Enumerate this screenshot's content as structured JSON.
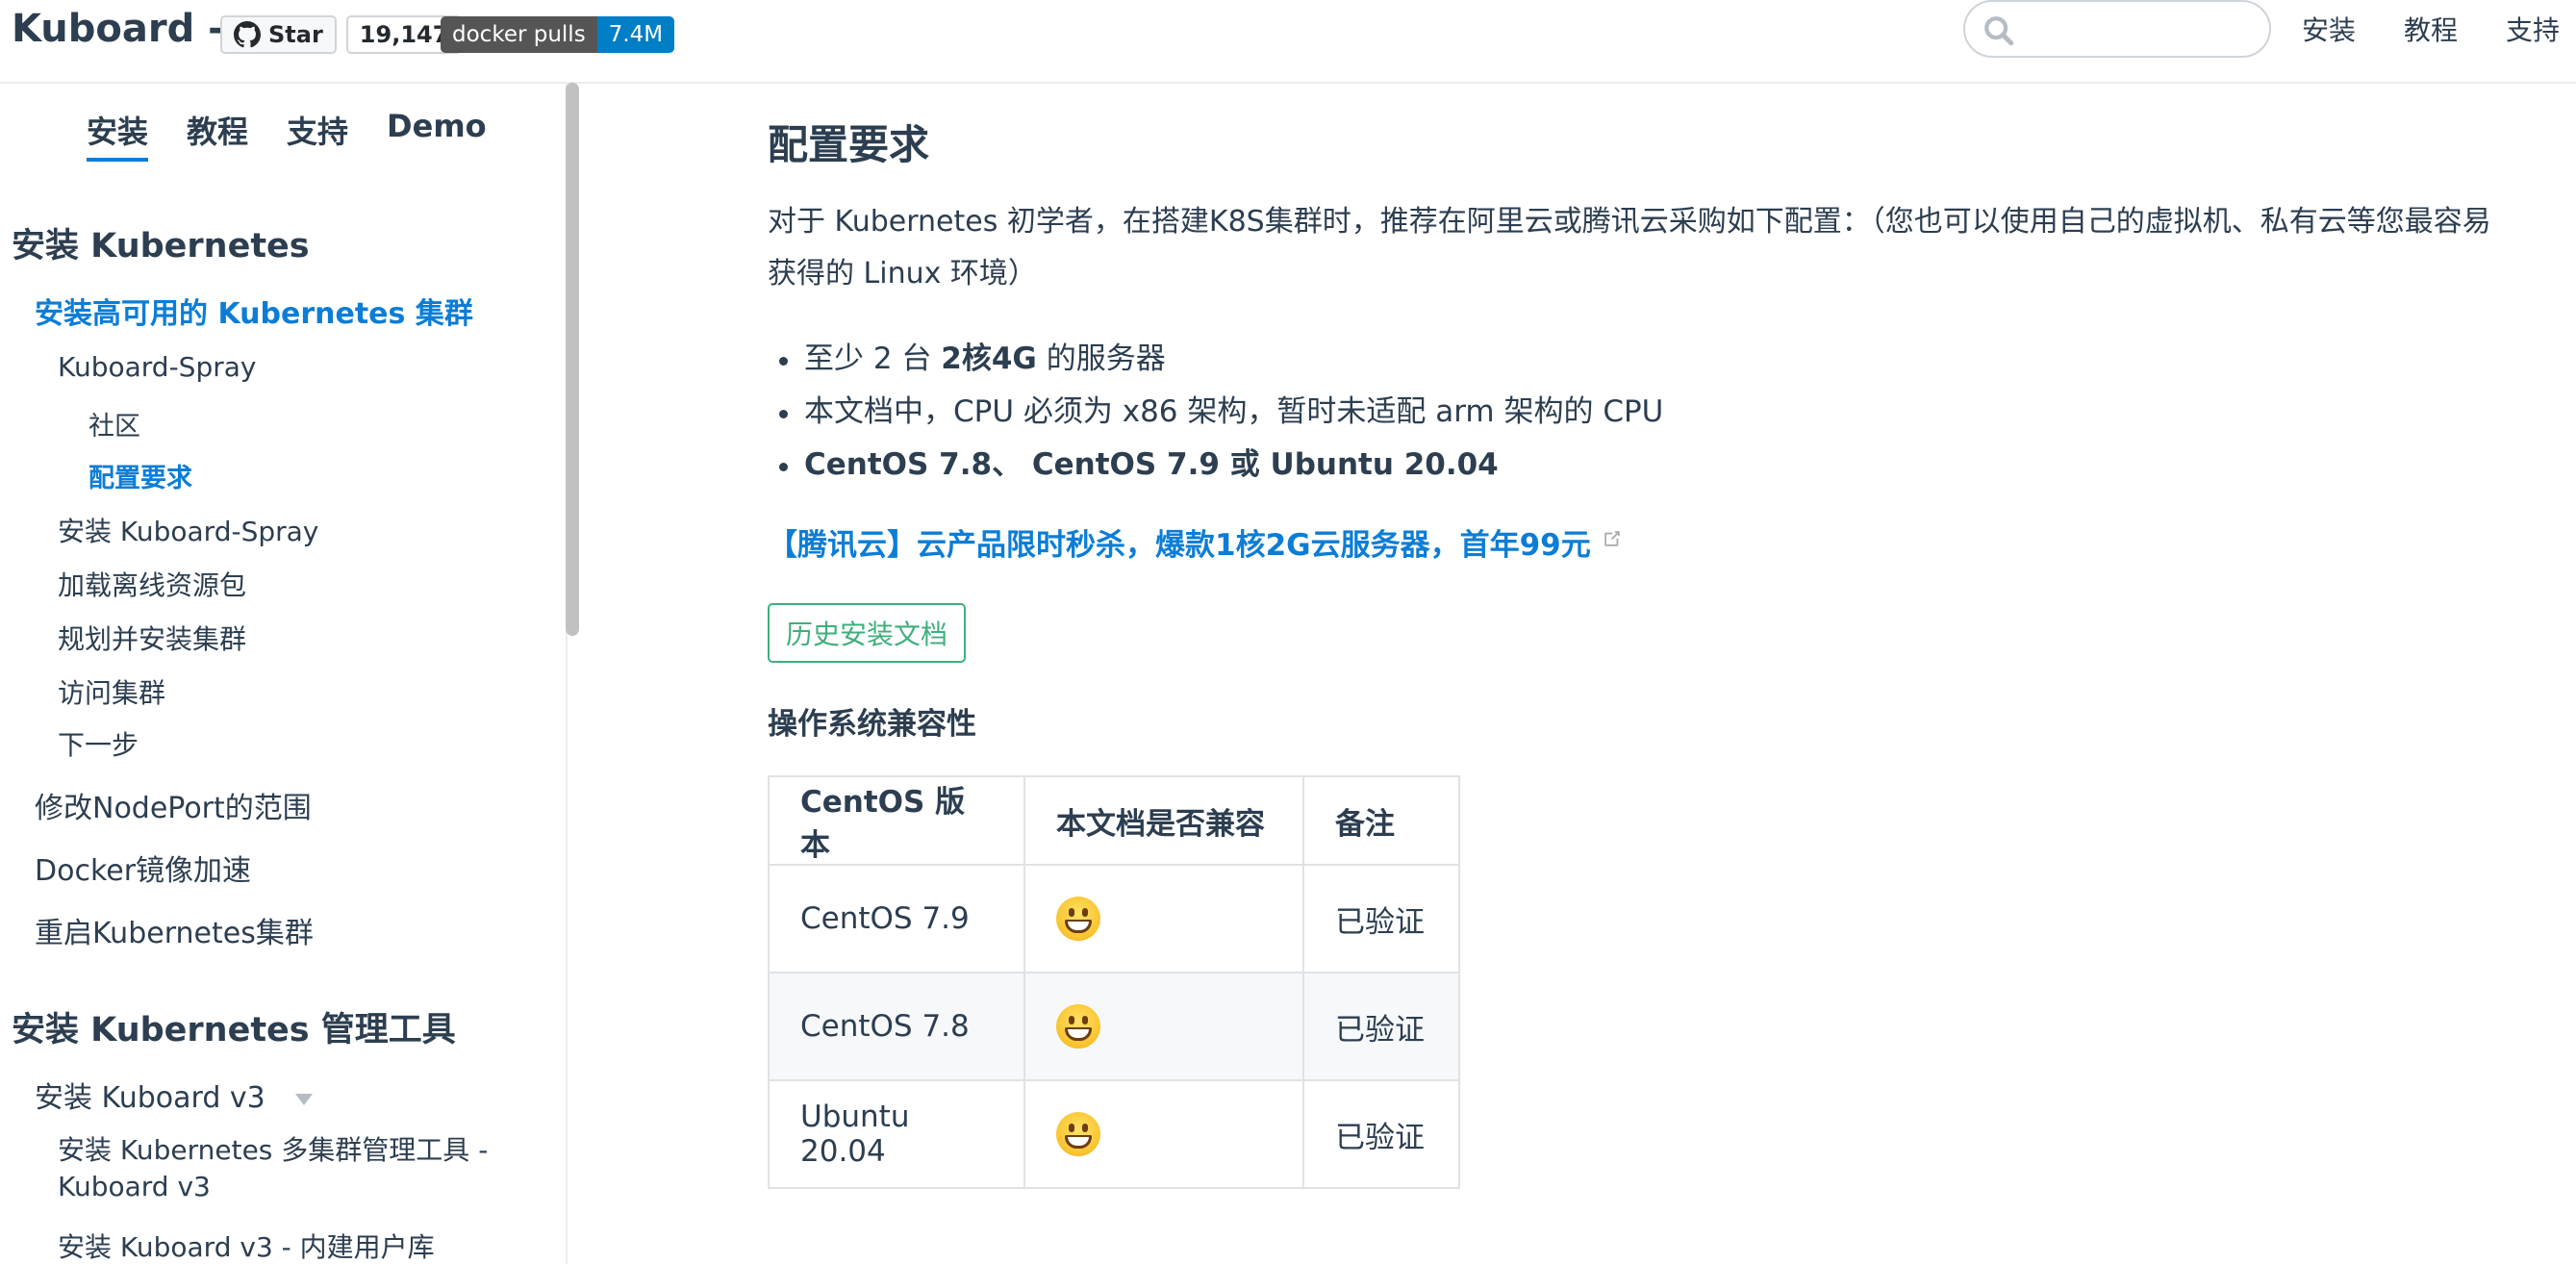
{
  "header": {
    "site_title": "Kuboard -",
    "github": {
      "star_label": "Star",
      "count": "19,147"
    },
    "docker": {
      "label": "docker pulls",
      "value": "7.4M"
    },
    "search": {
      "placeholder": ""
    },
    "nav": [
      "安装",
      "教程",
      "支持"
    ]
  },
  "sidebar": {
    "tabs": [
      "安装",
      "教程",
      "支持",
      "Demo"
    ],
    "active_tab": "安装",
    "group1": "安装 Kubernetes",
    "items": {
      "ha_cluster": "安装高可用的 Kubernetes 集群",
      "kuboard_spray": "Kuboard-Spray",
      "community": "社区",
      "requirements": "配置要求",
      "install_spray": "安装 Kuboard-Spray",
      "offline_pkg": "加载离线资源包",
      "plan_install": "规划并安装集群",
      "access": "访问集群",
      "next": "下一步",
      "nodeport": "修改NodePort的范围",
      "docker_mirror": "Docker镜像加速",
      "restart": "重启Kubernetes集群"
    },
    "group2": "安装 Kubernetes 管理工具",
    "items2": {
      "kuboard_v3": "安装 Kuboard v3",
      "multi_cluster": "安装 Kubernetes 多集群管理工具 - Kuboard v3",
      "builtin_users": "安装 Kuboard v3 - 内建用户库"
    }
  },
  "content": {
    "title": "配置要求",
    "intro": "对于 Kubernetes 初学者，在搭建K8S集群时，推荐在阿里云或腾讯云采购如下配置：（您也可以使用自己的虚拟机、私有云等您最容易获得的 Linux 环境）",
    "bullets": {
      "b1_pre": "至少 2 台 ",
      "b1_bold": "2核4G",
      "b1_post": " 的服务器",
      "b2": "本文档中，CPU 必须为 x86 架构，暂时未适配 arm 架构的 CPU",
      "b3_a": "CentOS 7.8",
      "b3_sep1": "、 ",
      "b3_b": "CentOS 7.9",
      "b3_sep2": " 或 ",
      "b3_c": "Ubuntu 20.04"
    },
    "promo_link": "【腾讯云】云产品限时秒杀，爆款1核2G云服务器，首年99元",
    "history_button": "历史安装文档",
    "compat_heading": "操作系统兼容性",
    "table": {
      "headers": [
        "CentOS 版本",
        "本文档是否兼容",
        "备注"
      ],
      "rows": [
        {
          "os": "CentOS 7.9",
          "compatible": "grinning-face-emoji",
          "note": "已验证"
        },
        {
          "os": "CentOS 7.8",
          "compatible": "grinning-face-emoji",
          "note": "已验证"
        },
        {
          "os": "Ubuntu 20.04",
          "compatible": "grinning-face-emoji",
          "note": "已验证"
        }
      ]
    }
  },
  "colors": {
    "accent": "#0c7dd6",
    "text": "#2c3e50",
    "button": "#3eaf7c"
  }
}
